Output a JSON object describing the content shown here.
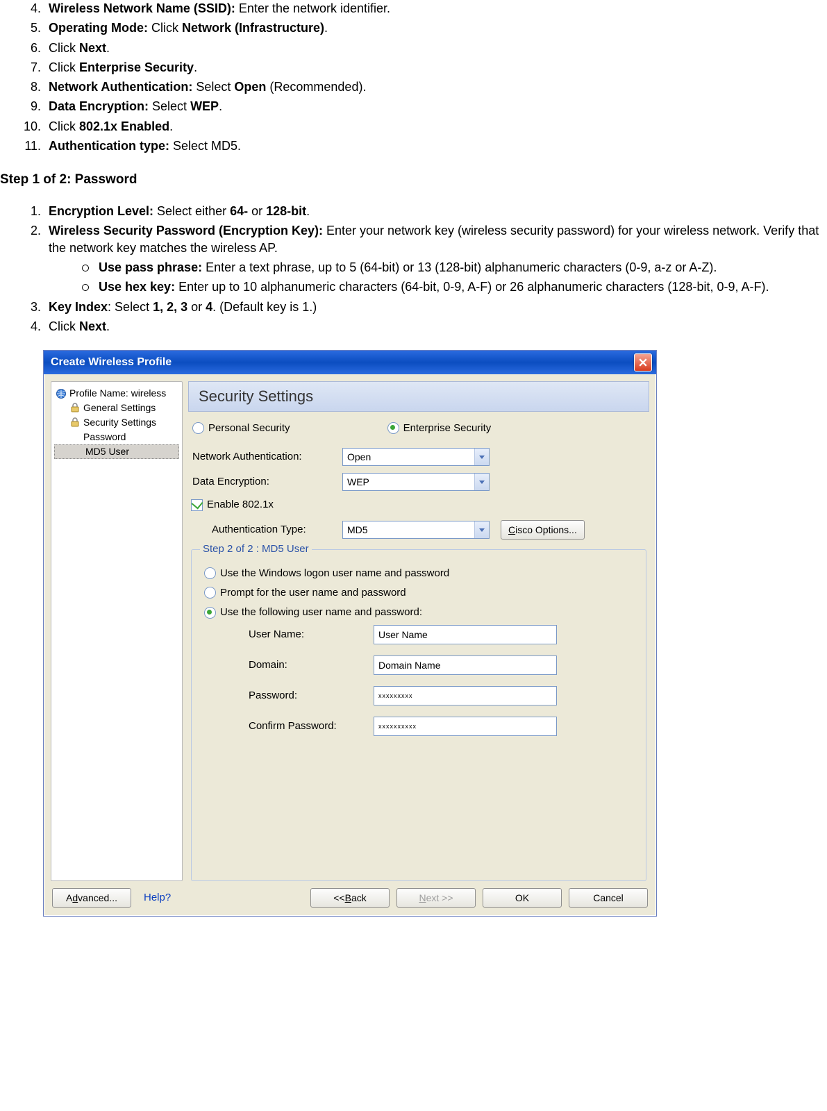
{
  "instructions_top": {
    "start": 4,
    "items": [
      {
        "bold": "Wireless Network Name (SSID):",
        "rest": " Enter the network identifier."
      },
      {
        "bold": "Operating Mode:",
        "rest_pre": " Click ",
        "bold2": "Network (Infrastructure)",
        "rest_post": "."
      },
      {
        "pre": "Click ",
        "bold": "Next",
        "post": "."
      },
      {
        "pre": "Click ",
        "bold": "Enterprise Security",
        "post": "."
      },
      {
        "bold": "Network Authentication:",
        "rest_pre": " Select ",
        "bold2": "Open",
        "rest_post": " (Recommended)."
      },
      {
        "bold": "Data Encryption:",
        "rest_pre": " Select ",
        "bold2": "WEP",
        "rest_post": "."
      },
      {
        "pre": "Click ",
        "bold": "802.1x Enabled",
        "post": "."
      },
      {
        "bold": "Authentication type:",
        "rest": " Select MD5."
      }
    ]
  },
  "step_heading": "Step 1 of 2: Password",
  "instructions_bottom": {
    "items": [
      {
        "bold": "Encryption Level:",
        "rest_pre": " Select either ",
        "bold2": "64-",
        "rest_mid": " or ",
        "bold3": "128-bit",
        "rest_post": "."
      },
      {
        "bold": "Wireless Security Password (Encryption Key):",
        "rest": " Enter your network key (wireless security password) for your wireless network. Verify that the network key matches the wireless AP.",
        "sub": [
          {
            "bold": "Use pass phrase:",
            "rest": " Enter a text phrase, up to 5 (64-bit) or 13 (128-bit) alphanumeric characters (0-9, a-z or A-Z)."
          },
          {
            "bold": "Use hex key:",
            "rest": " Enter up to 10 alphanumeric characters (64-bit, 0-9, A-F) or 26 alphanumeric characters (128-bit, 0-9, A-F)."
          }
        ]
      },
      {
        "bold": "Key Index",
        "rest_pre": ": Select ",
        "bold2": "1, 2, 3",
        "rest_mid": " or ",
        "bold3": "4",
        "rest_post": ". (Default key is 1.)"
      },
      {
        "pre": "Click ",
        "bold": "Next",
        "post": "."
      }
    ]
  },
  "dialog": {
    "title": "Create Wireless Profile",
    "tree": {
      "profile": "Profile Name: wireless",
      "general": "General Settings",
      "security": "Security Settings",
      "password": "Password",
      "md5user": "MD5 User"
    },
    "panel_title": "Security Settings",
    "radios": {
      "personal": "Personal Security",
      "enterprise": "Enterprise Security"
    },
    "fields": {
      "net_auth_label": "Network Authentication:",
      "net_auth_value": "Open",
      "data_enc_label": "Data Encryption:",
      "data_enc_value": "WEP",
      "enable_8021x": "Enable 802.1x",
      "auth_type_label": "Authentication Type:",
      "auth_type_value": "MD5",
      "cisco_btn": "Cisco Options..."
    },
    "step2": {
      "legend": "Step 2 of 2 : MD5 User",
      "opt1": "Use the Windows logon user name and password",
      "opt2": "Prompt for the user name and password",
      "opt3": "Use the following user name and password:",
      "user_label": "User Name:",
      "user_value": "User Name",
      "domain_label": "Domain:",
      "domain_value": "Domain Name",
      "pwd_label": "Password:",
      "pwd_value": "xxxxxxxxx",
      "cpwd_label": "Confirm Password:",
      "cpwd_value": "xxxxxxxxxx"
    },
    "buttons": {
      "advanced": "Advanced...",
      "help": "Help?",
      "back": "<< Back",
      "next": "Next >>",
      "ok": "OK",
      "cancel": "Cancel"
    }
  }
}
